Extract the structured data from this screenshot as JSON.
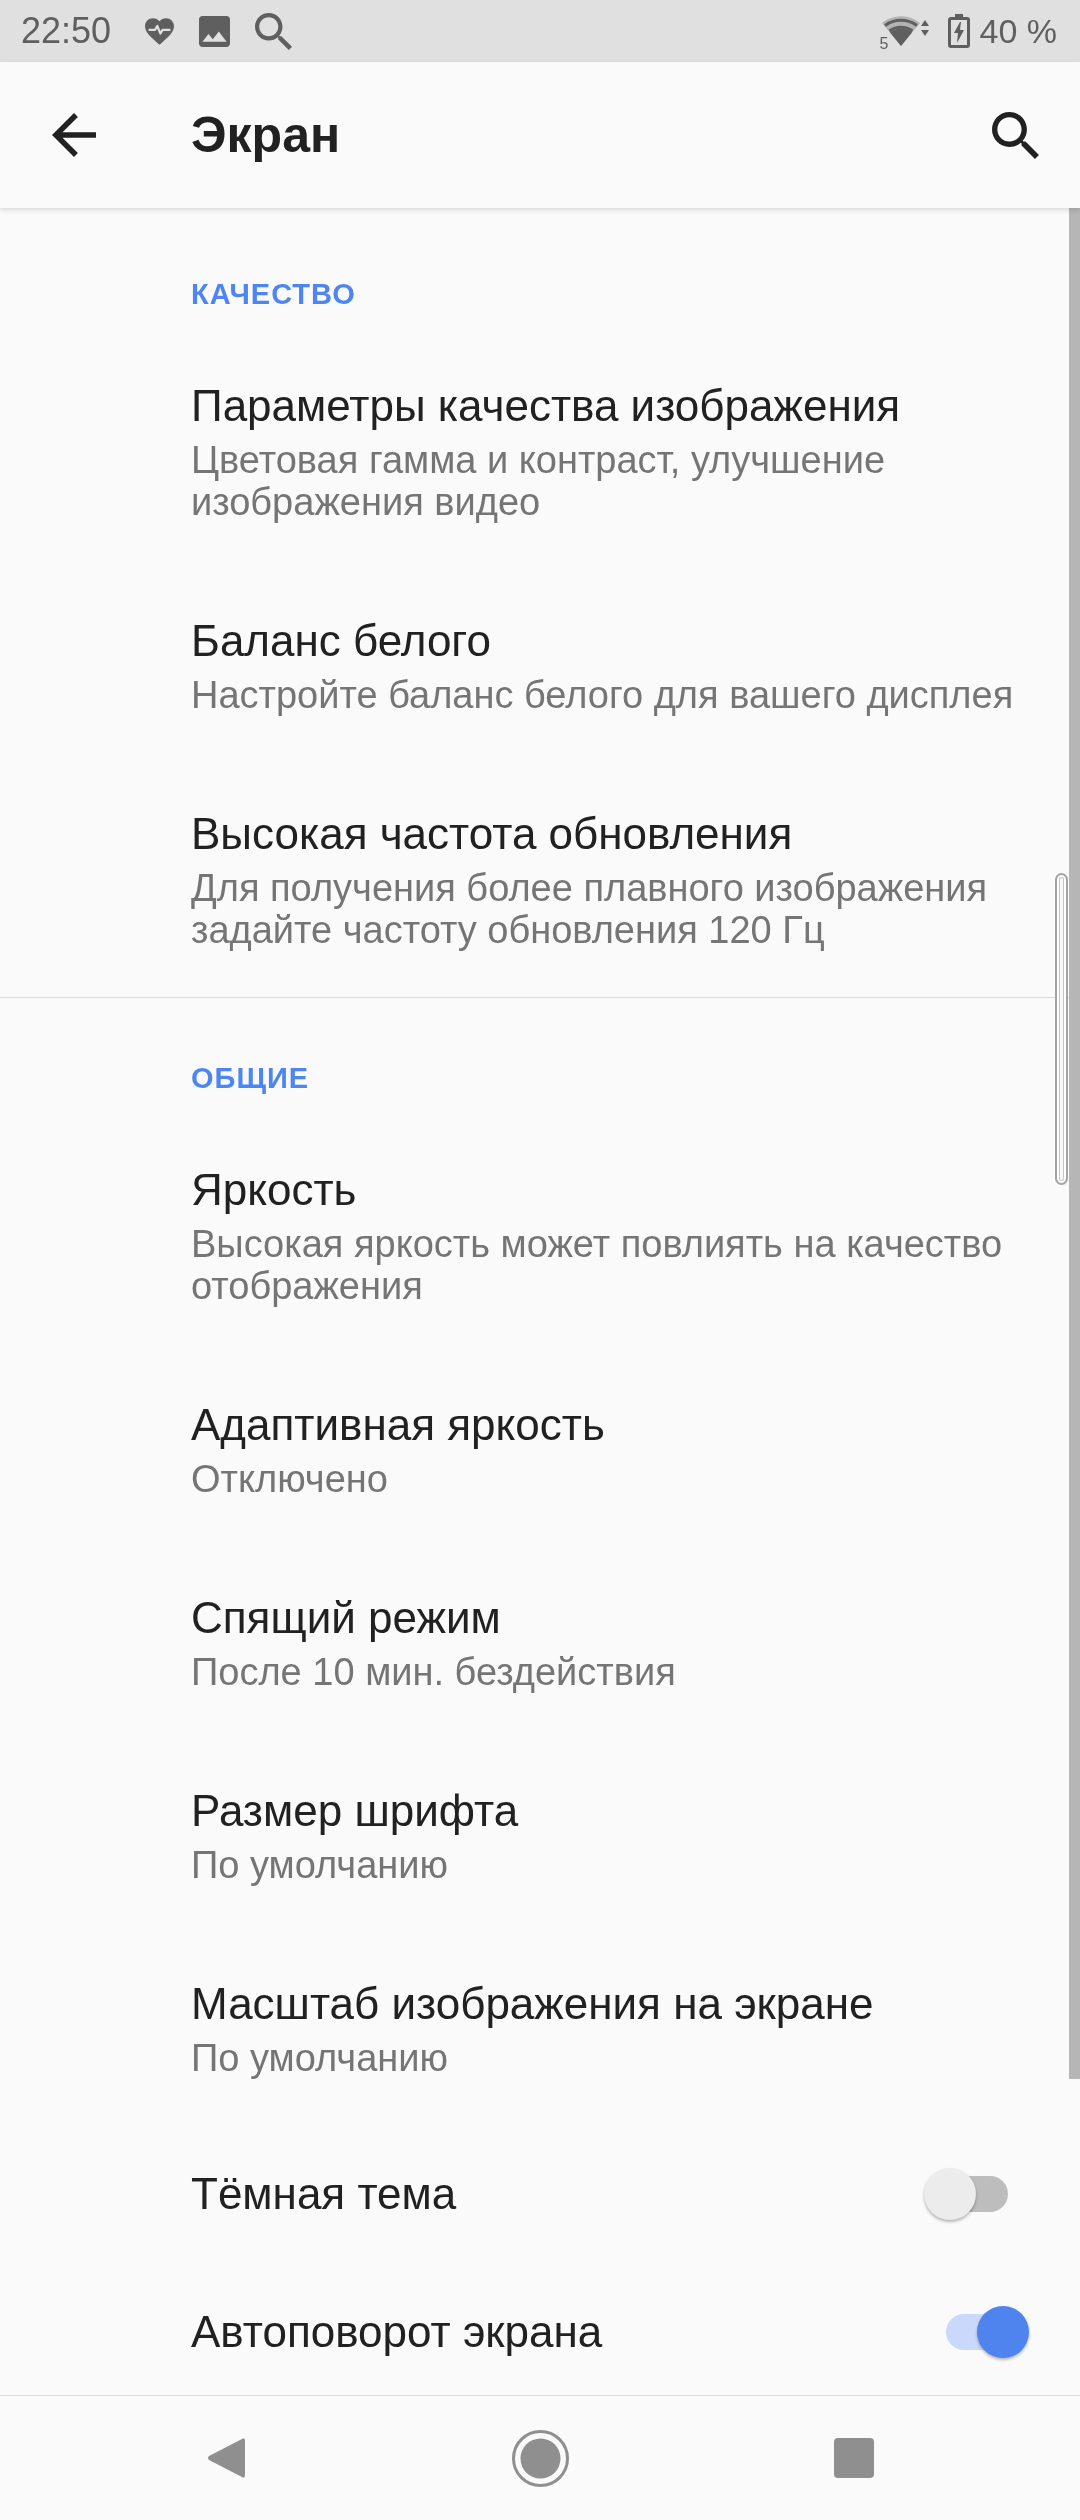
{
  "status_bar": {
    "time": "22:50",
    "network_type": "5",
    "battery": "40 %"
  },
  "toolbar": {
    "title": "Экран"
  },
  "sections": [
    {
      "header": "КАЧЕСТВО",
      "items": [
        {
          "kind": "text",
          "title": "Параметры качества изображения",
          "summary": "Цветовая гамма и контраст, улучшение изображения видео"
        },
        {
          "kind": "text",
          "title": "Баланс белого",
          "summary": "Настройте баланс белого для вашего дисплея"
        },
        {
          "kind": "text",
          "title": "Высокая частота обновления",
          "summary": "Для получения более плавного изображения задайте частоту обновления 120 Гц"
        }
      ]
    },
    {
      "header": "ОБЩИЕ",
      "items": [
        {
          "kind": "text",
          "title": "Яркость",
          "summary": "Высокая яркость может повлиять на качество отображения"
        },
        {
          "kind": "text",
          "title": "Адаптивная яркость",
          "summary": "Отключено"
        },
        {
          "kind": "text",
          "title": "Спящий режим",
          "summary": "После 10 мин. бездействия"
        },
        {
          "kind": "text",
          "title": "Размер шрифта",
          "summary": "По умолчанию"
        },
        {
          "kind": "text",
          "title": "Масштаб изображения на экране",
          "summary": "По умолчанию"
        },
        {
          "kind": "switch",
          "title": "Тёмная тема",
          "checked": false
        },
        {
          "kind": "switch",
          "title": "Автоповорот экрана",
          "checked": true
        }
      ]
    }
  ]
}
